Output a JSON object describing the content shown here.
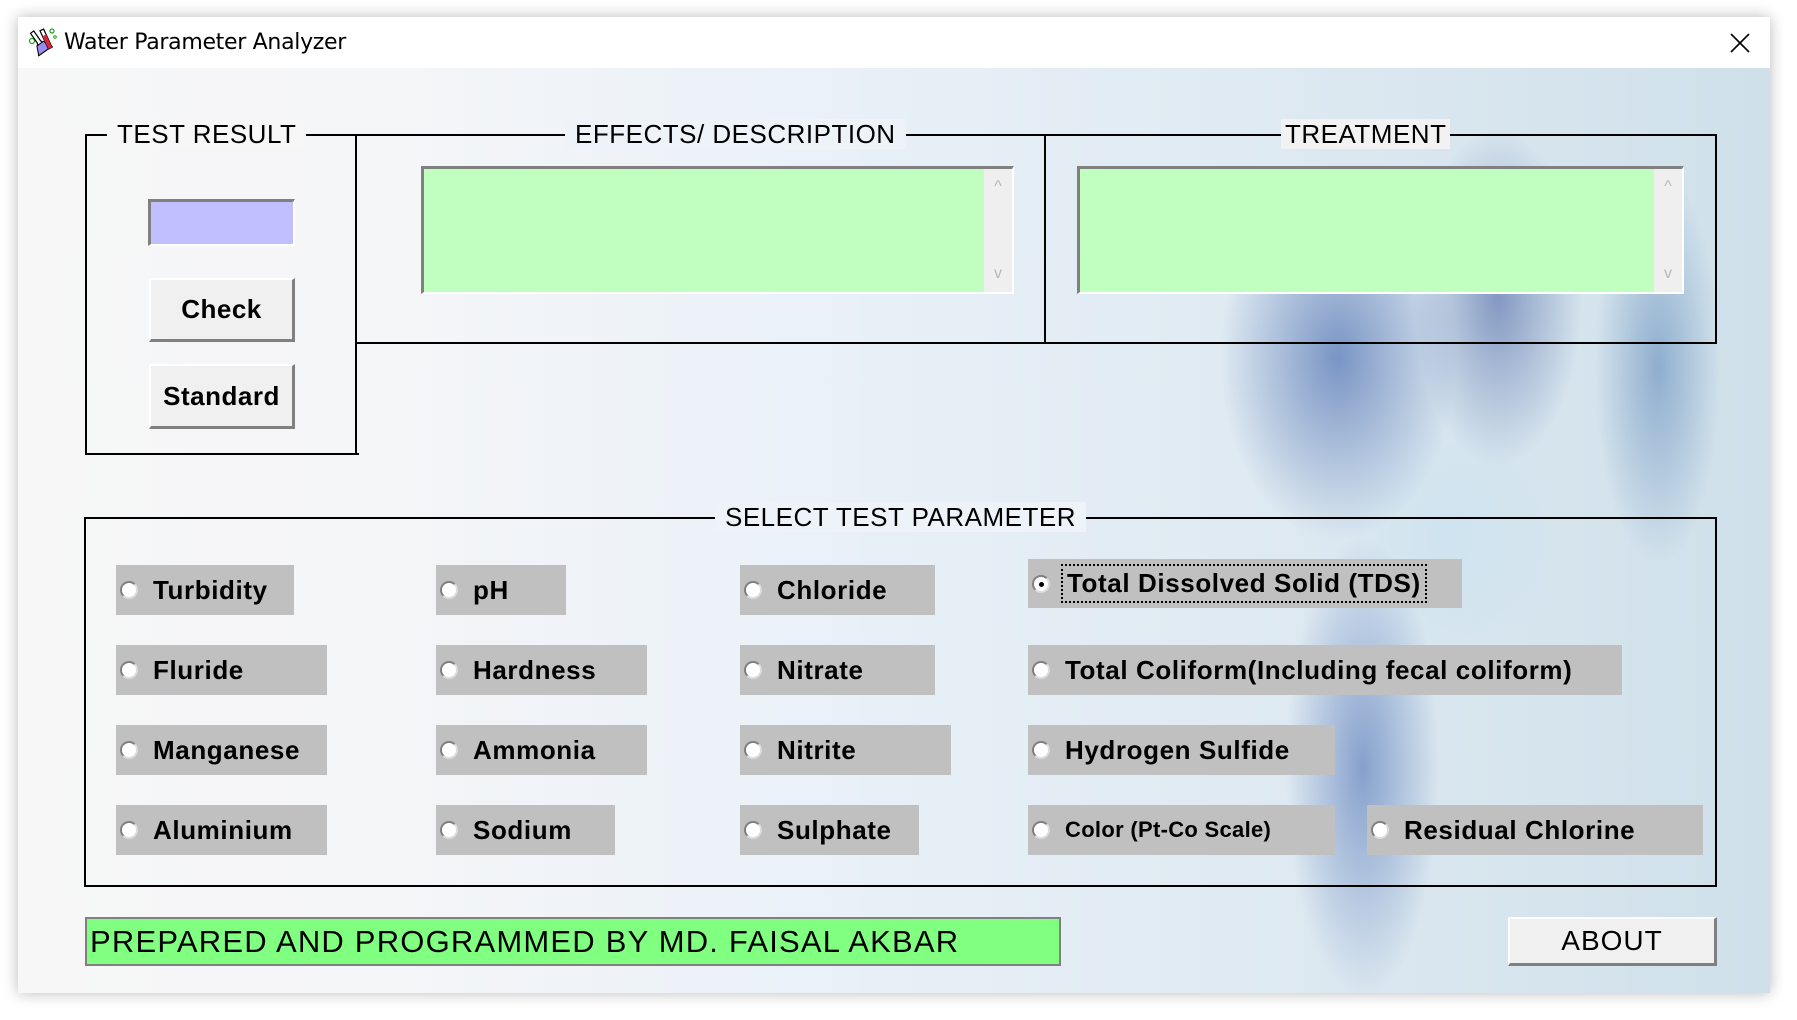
{
  "window": {
    "title": "Water Parameter Analyzer",
    "app_icon": "lab-flask-icon",
    "close_icon": "close-icon"
  },
  "test_result": {
    "frame_label": "TEST RESULT",
    "value": "",
    "check_label": "Check",
    "standard_label": "Standard"
  },
  "effects": {
    "frame_label": "EFFECTS/ DESCRIPTION",
    "text": ""
  },
  "treatment": {
    "frame_label": "TREATMENT",
    "text": ""
  },
  "scroll": {
    "up": "^",
    "down": "v"
  },
  "parameters": {
    "frame_label": "SELECT TEST PARAMETER",
    "selected": "Total Dissolved Solid (TDS)",
    "options": [
      {
        "label": "Turbidity",
        "checked": false
      },
      {
        "label": "pH",
        "checked": false
      },
      {
        "label": "Chloride",
        "checked": false
      },
      {
        "label": "Total Dissolved Solid (TDS)",
        "checked": true
      },
      {
        "label": "Fluride",
        "checked": false
      },
      {
        "label": "Hardness",
        "checked": false
      },
      {
        "label": "Nitrate",
        "checked": false
      },
      {
        "label": "Total Coliform(Including fecal coliform)",
        "checked": false
      },
      {
        "label": "Manganese",
        "checked": false
      },
      {
        "label": "Ammonia",
        "checked": false
      },
      {
        "label": "Nitrite",
        "checked": false
      },
      {
        "label": "Hydrogen Sulfide",
        "checked": false
      },
      {
        "label": "Aluminium",
        "checked": false
      },
      {
        "label": "Sodium",
        "checked": false
      },
      {
        "label": "Sulphate",
        "checked": false
      },
      {
        "label": "Color (Pt-Co Scale)",
        "checked": false
      },
      {
        "label": "Residual Chlorine",
        "checked": false
      }
    ]
  },
  "footer": {
    "credit": "PREPARED AND PROGRAMMED BY MD. FAISAL AKBAR",
    "about_label": "ABOUT"
  },
  "colors": {
    "text_area_bg": "#c0ffc0",
    "result_input_bg": "#c0c0ff",
    "credit_bg": "#80ff80",
    "radio_bg": "#c0c0c0"
  }
}
